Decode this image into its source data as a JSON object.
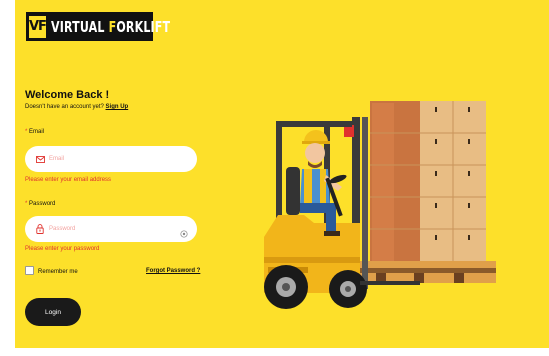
{
  "brand": {
    "logo_mark": "VF",
    "name_part1": "VIRTUAL ",
    "name_f": "F",
    "name_part2": "ORKLIFT"
  },
  "form": {
    "title": "Welcome Back !",
    "subline_text": "Doesn't have an account yet? ",
    "signup_link": "Sign Up",
    "email": {
      "label": "Email",
      "placeholder": "Email",
      "error": "Please enter your email address",
      "value": ""
    },
    "password": {
      "label": "Password",
      "placeholder": "Password",
      "error": "Please enter your password",
      "value": ""
    },
    "required_marker": "*",
    "remember_label": "Remember me",
    "remember_checked": false,
    "forgot_link": "Forgot Password ?",
    "login_button": "Login"
  },
  "illustration": {
    "name": "forklift-with-driver-and-boxes-illustration"
  },
  "colors": {
    "background": "#fde02a",
    "error": "#e0322e",
    "button": "#1a1a1a"
  }
}
